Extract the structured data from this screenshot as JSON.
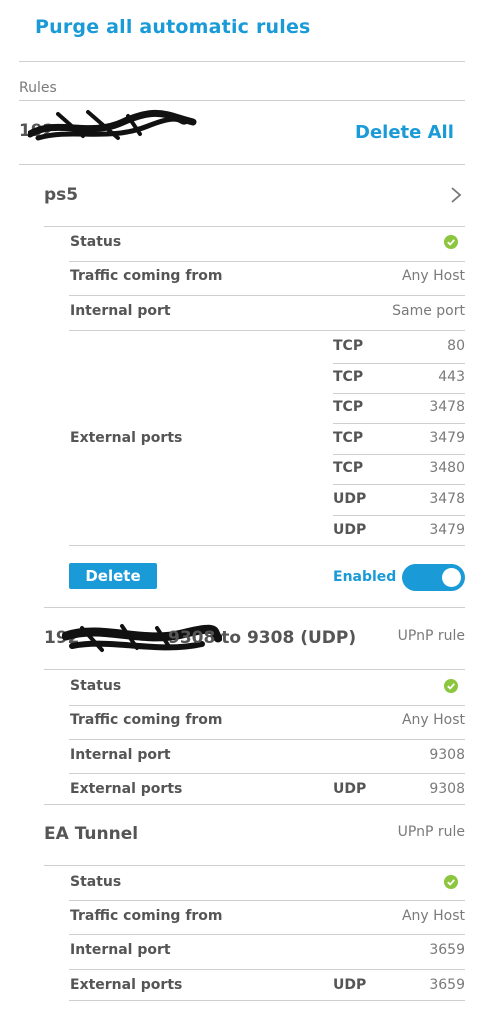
{
  "header": {
    "purge_label": "Purge all automatic rules",
    "rules_label": "Rules"
  },
  "host": {
    "ip_prefix": "192",
    "delete_all_label": "Delete All"
  },
  "rule_ps5": {
    "name": "ps5",
    "rows": {
      "status_label": "Status",
      "traffic_label": "Traffic coming from",
      "traffic_value": "Any Host",
      "internal_label": "Internal port",
      "internal_value": "Same port",
      "external_label": "External ports"
    },
    "ports": [
      {
        "proto": "TCP",
        "port": "80"
      },
      {
        "proto": "TCP",
        "port": "443"
      },
      {
        "proto": "TCP",
        "port": "3478"
      },
      {
        "proto": "TCP",
        "port": "3479"
      },
      {
        "proto": "TCP",
        "port": "3480"
      },
      {
        "proto": "UDP",
        "port": "3478"
      },
      {
        "proto": "UDP",
        "port": "3479"
      }
    ],
    "delete_label": "Delete",
    "enabled_label": "Enabled",
    "enabled": true
  },
  "rule_upnp1": {
    "title_prefix": "192",
    "title_suffix": "9308 to 9308 (UDP)",
    "type": "UPnP rule",
    "status_label": "Status",
    "traffic_label": "Traffic coming from",
    "traffic_value": "Any Host",
    "internal_label": "Internal port",
    "internal_value": "9308",
    "external_label": "External ports",
    "external_proto": "UDP",
    "external_port": "9308"
  },
  "rule_ea": {
    "title": "EA Tunnel",
    "type": "UPnP rule",
    "status_label": "Status",
    "traffic_label": "Traffic coming from",
    "traffic_value": "Any Host",
    "internal_label": "Internal port",
    "internal_value": "3659",
    "external_label": "External ports",
    "external_proto": "UDP",
    "external_port": "3659"
  },
  "colors": {
    "accent": "#1a9bd7",
    "status_ok": "#8cc63f",
    "divider": "#cfcfcf",
    "text": "#555555",
    "muted": "#7a7a7a"
  },
  "icons": {
    "status": "check-circle-icon",
    "expand": "chevron-right-icon",
    "redaction": "scribble-redaction"
  }
}
